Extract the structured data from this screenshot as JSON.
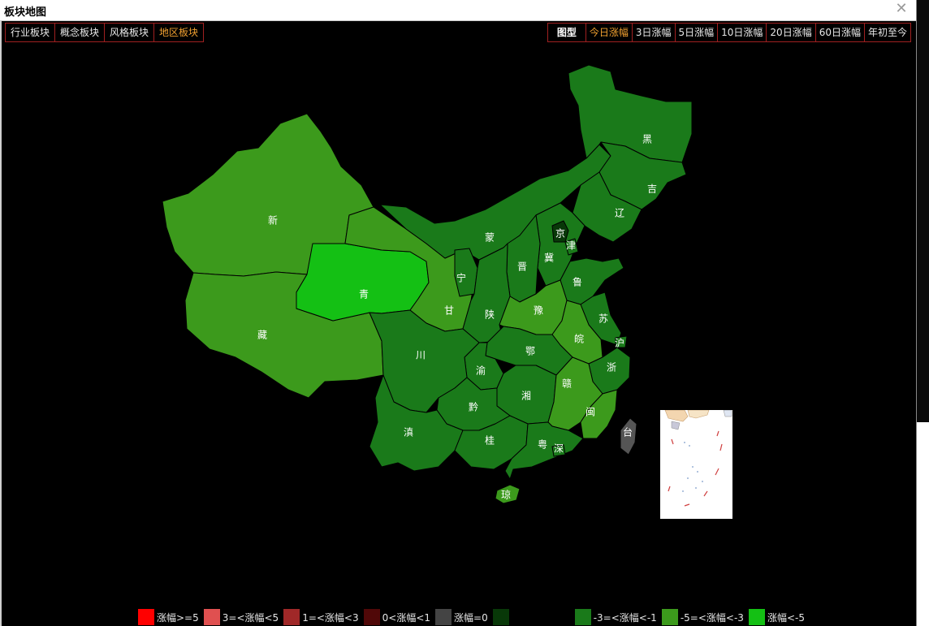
{
  "window": {
    "title": "板块地图"
  },
  "left_tabs": [
    {
      "label": "行业板块",
      "active": false
    },
    {
      "label": "概念板块",
      "active": false
    },
    {
      "label": "风格板块",
      "active": false
    },
    {
      "label": "地区板块",
      "active": true
    }
  ],
  "right_tabs": [
    {
      "label": "图型",
      "active": false
    },
    {
      "label": "今日涨幅",
      "active": true
    },
    {
      "label": "3日涨幅",
      "active": false
    },
    {
      "label": "5日涨幅",
      "active": false
    },
    {
      "label": "10日涨幅",
      "active": false
    },
    {
      "label": "20日涨幅",
      "active": false
    },
    {
      "label": "60日涨幅",
      "active": false
    },
    {
      "label": "年初至今",
      "active": false
    }
  ],
  "colors": {
    "dark_green": "#1a7a1a",
    "mid_green": "#3c9a1c",
    "bright_green": "#14c014",
    "deep_green": "#083808",
    "grey": "#555555"
  },
  "provinces": {
    "hei": "黑",
    "ji_lin": "吉",
    "liao": "辽",
    "meng": "蒙",
    "jing": "京",
    "jin_tianjin": "津",
    "ji_hebei": "冀",
    "jin_shanxi": "晋",
    "lu": "鲁",
    "ning": "宁",
    "gan": "甘",
    "xin": "新",
    "qing": "青",
    "zang": "藏",
    "shaan": "陕",
    "yu_henan": "豫",
    "su": "苏",
    "wan": "皖",
    "hu_shanghai": "沪",
    "e": "鄂",
    "chuan": "川",
    "yu_chongqing": "渝",
    "zhe": "浙",
    "xiang": "湘",
    "gan_jiangxi": "赣",
    "qian": "黔",
    "min": "闽",
    "dian": "滇",
    "gui": "桂",
    "yue": "粤",
    "shen": "深",
    "qiong": "琼",
    "tai": "台"
  },
  "legend": [
    {
      "label": "涨幅>=5",
      "color": "#ff0000"
    },
    {
      "label": "3=<涨幅<5",
      "color": "#e05050"
    },
    {
      "label": "1=<涨幅<3",
      "color": "#a02828"
    },
    {
      "label": "0<涨幅<1",
      "color": "#500808"
    },
    {
      "label": "涨幅=0",
      "color": "#444444"
    },
    {
      "label": "",
      "color": "#083808"
    },
    {
      "label": "-3=<涨幅<-1",
      "color": "#1a7a1a"
    },
    {
      "label": "-5=<涨幅<-3",
      "color": "#3c9a1c"
    },
    {
      "label": "涨幅<-5",
      "color": "#14c014"
    }
  ]
}
